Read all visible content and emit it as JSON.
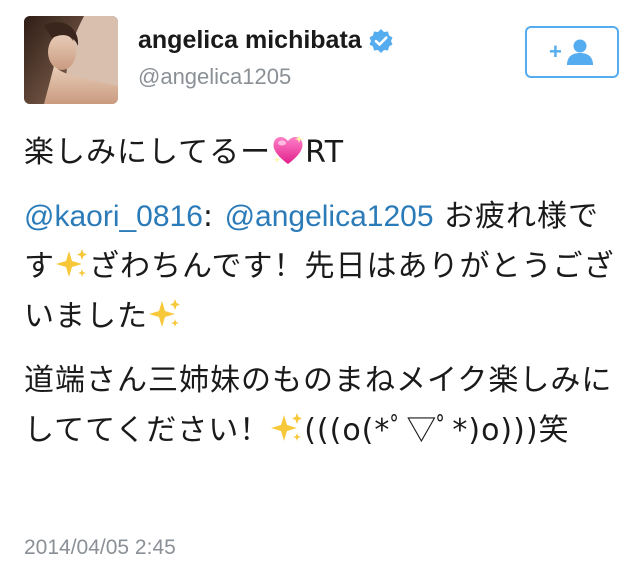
{
  "user": {
    "display_name": "angelica michibata",
    "handle": "@angelica1205",
    "verified": true,
    "avatar_icon": "profile-photo"
  },
  "follow_button": {
    "icon": "follow-user-icon",
    "label": "+"
  },
  "tweet": {
    "line1_text": "楽しみにしてるー",
    "line1_emoji": "sparkling-heart",
    "line1_suffix": "RT",
    "mention1": "@kaori_0816",
    "mention_sep": ": ",
    "mention2": "@angelica1205",
    "para2_a": " お疲れ様です",
    "para2_b": "ざわちんです！先日はありがとうございました",
    "para3_a": "道端さん三姉妹のものまねメイク楽しみにしててください！",
    "para3_b": "(((o(*ﾟ▽ﾟ*)o)))笑",
    "sparkle_emoji": "sparkles"
  },
  "timestamp": "2014/04/05 2:45",
  "colors": {
    "link": "#2b7bb9",
    "verified": "#55acee",
    "secondary_text": "#8a9096",
    "follow_border": "#55acee"
  }
}
